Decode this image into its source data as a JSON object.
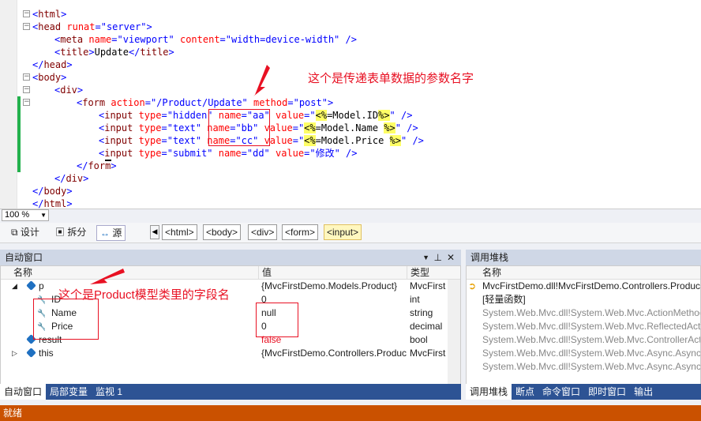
{
  "editor": {
    "lines": [
      {
        "indent": 0,
        "parts": [
          {
            "t": "<",
            "c": "br"
          },
          {
            "t": "html",
            "c": "tg"
          },
          {
            "t": ">",
            "c": "br"
          }
        ]
      },
      {
        "indent": 0,
        "parts": [
          {
            "t": "<",
            "c": "br"
          },
          {
            "t": "head",
            "c": "tg"
          },
          {
            "t": " runat",
            "c": "at"
          },
          {
            "t": "=",
            "c": "br"
          },
          {
            "t": "\"server\"",
            "c": "vl"
          },
          {
            "t": ">",
            "c": "br"
          }
        ]
      },
      {
        "indent": 1,
        "parts": [
          {
            "t": "<",
            "c": "br"
          },
          {
            "t": "meta",
            "c": "tg"
          },
          {
            "t": " name",
            "c": "at"
          },
          {
            "t": "=",
            "c": "br"
          },
          {
            "t": "\"viewport\"",
            "c": "vl"
          },
          {
            "t": " content",
            "c": "at"
          },
          {
            "t": "=",
            "c": "br"
          },
          {
            "t": "\"width=device-width\"",
            "c": "vl"
          },
          {
            "t": " />",
            "c": "br"
          }
        ]
      },
      {
        "indent": 1,
        "parts": [
          {
            "t": "<",
            "c": "br"
          },
          {
            "t": "title",
            "c": "tg"
          },
          {
            "t": ">",
            "c": "br"
          },
          {
            "t": "Update",
            "c": ""
          },
          {
            "t": "</",
            "c": "br"
          },
          {
            "t": "title",
            "c": "tg"
          },
          {
            "t": ">",
            "c": "br"
          }
        ]
      },
      {
        "indent": 0,
        "parts": [
          {
            "t": "</",
            "c": "br"
          },
          {
            "t": "head",
            "c": "tg"
          },
          {
            "t": ">",
            "c": "br"
          }
        ]
      },
      {
        "indent": 0,
        "parts": [
          {
            "t": "<",
            "c": "br"
          },
          {
            "t": "body",
            "c": "tg"
          },
          {
            "t": ">",
            "c": "br"
          }
        ]
      },
      {
        "indent": 1,
        "parts": [
          {
            "t": "<",
            "c": "br"
          },
          {
            "t": "div",
            "c": "tg"
          },
          {
            "t": ">",
            "c": "br"
          }
        ]
      },
      {
        "indent": 2,
        "parts": [
          {
            "t": "<",
            "c": "br"
          },
          {
            "t": "form",
            "c": "tg"
          },
          {
            "t": " action",
            "c": "at"
          },
          {
            "t": "=",
            "c": "br"
          },
          {
            "t": "\"/Product/Update\"",
            "c": "vl"
          },
          {
            "t": " method",
            "c": "at"
          },
          {
            "t": "=",
            "c": "br"
          },
          {
            "t": "\"post\"",
            "c": "vl"
          },
          {
            "t": ">",
            "c": "br"
          }
        ]
      },
      {
        "indent": 3,
        "parts": [
          {
            "t": "<",
            "c": "br"
          },
          {
            "t": "input",
            "c": "tg"
          },
          {
            "t": " type",
            "c": "at"
          },
          {
            "t": "=",
            "c": "br"
          },
          {
            "t": "\"hidden\"",
            "c": "vl"
          },
          {
            "t": " name",
            "c": "at"
          },
          {
            "t": "=",
            "c": "br"
          },
          {
            "t": "\"aa\"",
            "c": "vl"
          },
          {
            "t": " value",
            "c": "at"
          },
          {
            "t": "=",
            "c": "br"
          },
          {
            "t": "\"",
            "c": "vl"
          },
          {
            "t": "<%",
            "c": "asp"
          },
          {
            "t": "=Model.ID",
            "c": ""
          },
          {
            "t": "%>",
            "c": "asp"
          },
          {
            "t": "\"",
            "c": "vl"
          },
          {
            "t": " />",
            "c": "br"
          }
        ]
      },
      {
        "indent": 3,
        "parts": [
          {
            "t": "<",
            "c": "br"
          },
          {
            "t": "input",
            "c": "tg"
          },
          {
            "t": " type",
            "c": "at"
          },
          {
            "t": "=",
            "c": "br"
          },
          {
            "t": "\"text\"",
            "c": "vl"
          },
          {
            "t": " name",
            "c": "at"
          },
          {
            "t": "=",
            "c": "br"
          },
          {
            "t": "\"bb\"",
            "c": "vl"
          },
          {
            "t": " value",
            "c": "at"
          },
          {
            "t": "=",
            "c": "br"
          },
          {
            "t": "\"",
            "c": "vl"
          },
          {
            "t": "<%",
            "c": "asp"
          },
          {
            "t": "=Model.Name ",
            "c": ""
          },
          {
            "t": "%>",
            "c": "asp"
          },
          {
            "t": "\"",
            "c": "vl"
          },
          {
            "t": " />",
            "c": "br"
          }
        ]
      },
      {
        "indent": 3,
        "parts": [
          {
            "t": "<",
            "c": "br"
          },
          {
            "t": "input",
            "c": "tg"
          },
          {
            "t": " type",
            "c": "at"
          },
          {
            "t": "=",
            "c": "br"
          },
          {
            "t": "\"text\"",
            "c": "vl"
          },
          {
            "t": " name",
            "c": "at"
          },
          {
            "t": "=",
            "c": "br"
          },
          {
            "t": "\"cc\"",
            "c": "vl"
          },
          {
            "t": " value",
            "c": "at"
          },
          {
            "t": "=",
            "c": "br"
          },
          {
            "t": "\"",
            "c": "vl"
          },
          {
            "t": "<%",
            "c": "asp"
          },
          {
            "t": "=Model.Price ",
            "c": ""
          },
          {
            "t": "%>",
            "c": "asp"
          },
          {
            "t": "\"",
            "c": "vl"
          },
          {
            "t": " />",
            "c": "br"
          }
        ]
      },
      {
        "indent": 3,
        "parts": [
          {
            "t": "<",
            "c": "br"
          },
          {
            "t": "input",
            "c": "tg"
          },
          {
            "t": " type",
            "c": "at"
          },
          {
            "t": "=",
            "c": "br"
          },
          {
            "t": "\"submit\"",
            "c": "vl"
          },
          {
            "t": " name",
            "c": "at"
          },
          {
            "t": "=",
            "c": "br"
          },
          {
            "t": "\"dd\"",
            "c": "vl"
          },
          {
            "t": " value",
            "c": "at"
          },
          {
            "t": "=",
            "c": "br"
          },
          {
            "t": "\"修改\"",
            "c": "vl"
          },
          {
            "t": " />",
            "c": "br"
          }
        ]
      },
      {
        "indent": 2,
        "parts": [
          {
            "t": "</",
            "c": "br"
          },
          {
            "t": "form",
            "c": "tg"
          },
          {
            "t": ">",
            "c": "br"
          }
        ]
      },
      {
        "indent": 1,
        "parts": [
          {
            "t": "</",
            "c": "br"
          },
          {
            "t": "div",
            "c": "tg"
          },
          {
            "t": ">",
            "c": "br"
          }
        ]
      },
      {
        "indent": 0,
        "parts": [
          {
            "t": "</",
            "c": "br"
          },
          {
            "t": "body",
            "c": "tg"
          },
          {
            "t": ">",
            "c": "br"
          }
        ]
      },
      {
        "indent": 0,
        "parts": [
          {
            "t": "</",
            "c": "br"
          },
          {
            "t": "html",
            "c": "tg"
          },
          {
            "t": ">",
            "c": "br"
          }
        ]
      }
    ],
    "annotation_top": "这个是传递表单数据的参数名字",
    "annotation_bottom": "这个是Product模型类里的字段名"
  },
  "zoom": {
    "value": "100 %"
  },
  "viewbar": {
    "design": "设计",
    "split": "拆分",
    "source": "源",
    "crumbs": [
      "<html>",
      "<body>",
      "<div>",
      "<form>",
      "<input>"
    ]
  },
  "autos": {
    "title": "自动窗口",
    "headers": {
      "name": "名称",
      "value": "值",
      "type": "类型"
    },
    "rows": [
      {
        "name": "p",
        "value": "{MvcFirstDemo.Models.Product}",
        "type": "MvcFirst",
        "level": 0,
        "expander": "◢",
        "icon": "object-icon"
      },
      {
        "name": "ID",
        "value": "0",
        "type": "int",
        "level": 1,
        "expander": "",
        "icon": "wrench-icon"
      },
      {
        "name": "Name",
        "value": "null",
        "type": "string",
        "level": 1,
        "expander": "",
        "icon": "wrench-icon"
      },
      {
        "name": "Price",
        "value": "0",
        "type": "decimal",
        "level": 1,
        "expander": "",
        "icon": "wrench-icon"
      },
      {
        "name": "result",
        "value": "false",
        "type": "bool",
        "level": 0,
        "expander": "",
        "icon": "object-icon",
        "value_red": true
      },
      {
        "name": "this",
        "value": "{MvcFirstDemo.Controllers.Product",
        "type": "MvcFirst",
        "level": 0,
        "expander": "▷",
        "icon": "object-icon"
      }
    ],
    "tabs": [
      "自动窗口",
      "局部变量",
      "监视 1"
    ]
  },
  "callstack": {
    "title": "调用堆栈",
    "header": "名称",
    "rows": [
      {
        "text": "MvcFirstDemo.dll!MvcFirstDemo.Controllers.Product",
        "grey": false
      },
      {
        "text": "[轻量函数]",
        "grey": false
      },
      {
        "text": "System.Web.Mvc.dll!System.Web.Mvc.ActionMethod",
        "grey": true
      },
      {
        "text": "System.Web.Mvc.dll!System.Web.Mvc.ReflectedActi",
        "grey": true
      },
      {
        "text": "System.Web.Mvc.dll!System.Web.Mvc.ControllerAct",
        "grey": true
      },
      {
        "text": "System.Web.Mvc.dll!System.Web.Mvc.Async.AsyncC",
        "grey": true
      },
      {
        "text": "System.Web.Mvc.dll!System.Web.Mvc.Async.AsyncR",
        "grey": true
      }
    ],
    "tabs": [
      "调用堆栈",
      "断点",
      "命令窗口",
      "即时窗口",
      "输出"
    ]
  },
  "status": {
    "text": "就绪"
  },
  "colors": {
    "status_bg": "#ca5100",
    "tab_bg": "#2d5394",
    "panel_title_bg": "#cfd7e6",
    "annotation": "#e81123"
  }
}
